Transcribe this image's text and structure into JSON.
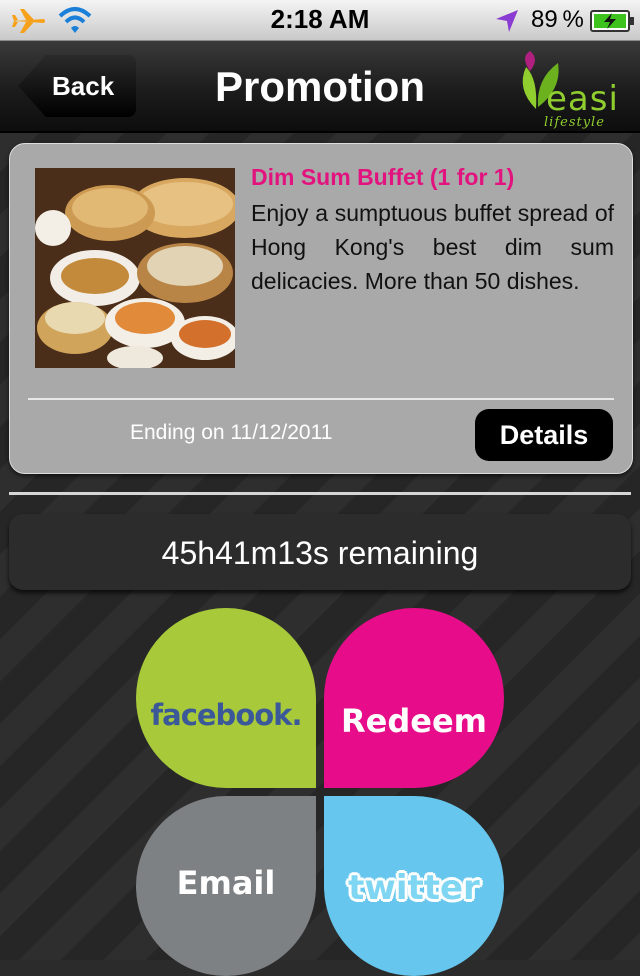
{
  "status_bar": {
    "time": "2:18 AM",
    "battery_percent": "89 %",
    "icons": [
      "airplane-icon",
      "wifi-icon",
      "location-arrow-icon",
      "battery-charging-icon"
    ]
  },
  "nav": {
    "back_label": "Back",
    "title": "Promotion",
    "logo_text": "easi",
    "logo_subtext": "lifestyle"
  },
  "promo": {
    "title": "Dim Sum Buffet (1 for 1)",
    "description": "Enjoy a sumptuous buffet spread of Hong Kong's best dim sum delicacies. More than 50 dishes.",
    "ending": "Ending on 11/12/2011",
    "details_label": "Details"
  },
  "timer": {
    "text": "45h41m13s remaining"
  },
  "actions": {
    "facebook_label": "facebook.",
    "redeem_label": "Redeem",
    "email_label": "Email",
    "twitter_label": "twitter"
  },
  "colors": {
    "accent_pink": "#e70d8a",
    "facebook_green": "#a7c93a",
    "email_gray": "#7e8184",
    "twitter_blue": "#66c6ee",
    "brand_green": "#8fce2e"
  }
}
